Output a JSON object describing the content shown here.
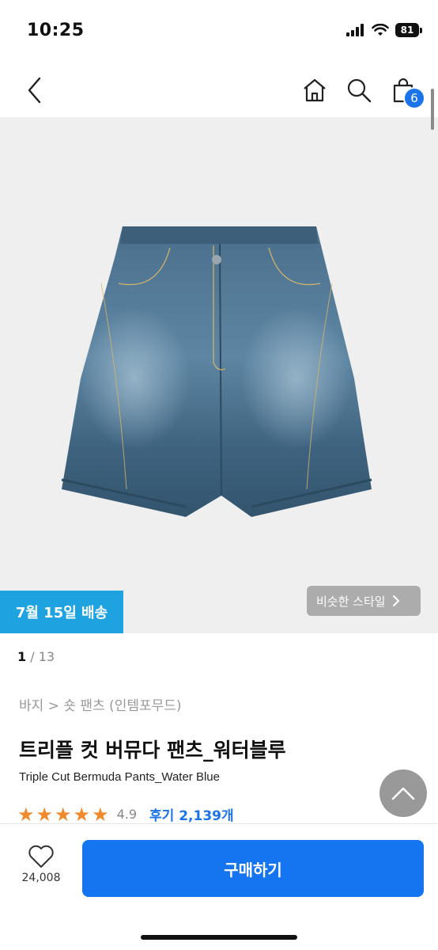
{
  "status": {
    "time": "10:25",
    "battery": "81"
  },
  "cart": {
    "count": "6"
  },
  "badges": {
    "delivery": "7월 15일 배송",
    "similar": "비슷한 스타일"
  },
  "pager": {
    "current": "1",
    "total": " / 13"
  },
  "breadcrumb": "바지 > 숏 팬츠 (인템포무드)",
  "product": {
    "name_ko": "트리플 컷 버뮤다 팬츠_워터블루",
    "name_en": "Triple Cut Bermuda Pants_Water Blue",
    "rating": "4.9",
    "rating_fraction": 0.98,
    "reviews": "후기 2,139개"
  },
  "bottom": {
    "wish_count": "24,008",
    "buy_label": "구매하기"
  },
  "colors": {
    "accent": "#1575f0",
    "delivery": "#1fa2e0",
    "star": "#f08a2c",
    "badge": "#1a73e8"
  },
  "icons": [
    "back-arrow-icon",
    "home-icon",
    "search-icon",
    "shopping-bag-icon",
    "chevron-right-icon",
    "chevron-up-icon",
    "heart-icon",
    "star-icon"
  ]
}
